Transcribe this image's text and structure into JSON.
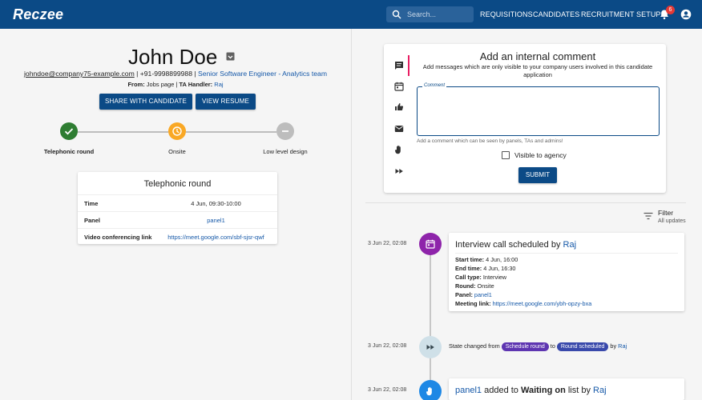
{
  "app": {
    "logo": "Reczee"
  },
  "topbar": {
    "search_placeholder": "Search...",
    "nav": [
      "REQUISITIONS",
      "CANDIDATES",
      "RECRUITMENT SETUP"
    ],
    "notifications_count": "6",
    "colors": {
      "bar": "#0b4a86",
      "badge": "#e53935"
    }
  },
  "candidate": {
    "name": "John Doe",
    "email": "johndoe@company75-example.com",
    "sep1": " | ",
    "phone": "+91-9998899988",
    "sep2": " | ",
    "role": "Senior Software Engineer - Analytics team",
    "from_label": "From:",
    "from_value": " Jobs page | ",
    "ta_label": "TA Handler:",
    "ta_value": "Raj",
    "share_button": "SHARE WITH CANDIDATE",
    "resume_button": "VIEW RESUME"
  },
  "stepper": {
    "steps": [
      {
        "label": "Telephonic round",
        "state": "done",
        "color": "#2e7d32",
        "icon": "check-icon"
      },
      {
        "label": "Onsite",
        "state": "current",
        "color": "#f9a825",
        "icon": "clock-icon"
      },
      {
        "label": "Low level design",
        "state": "pending",
        "color": "#bdbdbd",
        "icon": "minus-icon"
      }
    ]
  },
  "round_card": {
    "title": "Telephonic round",
    "rows": [
      {
        "key": "Time",
        "value": "4 Jun, 09:30-10:00"
      },
      {
        "key": "Panel",
        "value": "panel1"
      },
      {
        "key": "Video conferencing link",
        "value": "https://meet.google.com/sbf-sjsr-qwf"
      }
    ]
  },
  "comment": {
    "tabs": [
      "comment-icon",
      "calendar-icon",
      "thumbs-icon",
      "mail-icon",
      "hand-icon",
      "fast-forward-icon"
    ],
    "title": "Add an internal comment",
    "subtitle": "Add messages which are only visible to your company users involved in this candidate application",
    "field_label": "Comment",
    "hint": "Add a comment which can be seen by panels, TAs and admins!",
    "checkbox_label": "Visible to agency",
    "submit": "SUBMIT"
  },
  "filter": {
    "label": "Filter",
    "value": "All updates"
  },
  "timeline": {
    "events": [
      {
        "date": "3 Jun 22, 02:08",
        "icon": "calendar-icon",
        "color": "#8e24aa",
        "title_prefix": "Interview call scheduled by ",
        "title_user": "Raj",
        "details": [
          {
            "key": "Start time:",
            "value": " 4 Jun, 16:00"
          },
          {
            "key": "End time:",
            "value": " 4 Jun, 16:30"
          },
          {
            "key": "Call type:",
            "value": " Interview"
          },
          {
            "key": "Round:",
            "value": " Onsite"
          },
          {
            "key": "Panel:",
            "value": " panel1"
          },
          {
            "key": "Meeting link:",
            "value": " https://meet.google.com/ybh-opzy-bxa"
          }
        ]
      },
      {
        "date": "3 Jun 22, 02:08",
        "icon": "fast-forward-icon",
        "color": "#cfe0e8",
        "text_prefix": "State changed from ",
        "from_chip": "Schedule round",
        "from_color": "#5e35b1",
        "text_mid": " to ",
        "to_chip": "Round scheduled",
        "to_color": "#3949ab",
        "text_by": " by ",
        "user": "Raj"
      },
      {
        "date": "3 Jun 22, 02:08",
        "icon": "hand-icon",
        "color": "#1e88e5",
        "title_user": "panel1",
        "title_mid": " added to ",
        "title_bold": "Waiting on",
        "title_end": " list by ",
        "title_by": "Raj"
      }
    ]
  }
}
